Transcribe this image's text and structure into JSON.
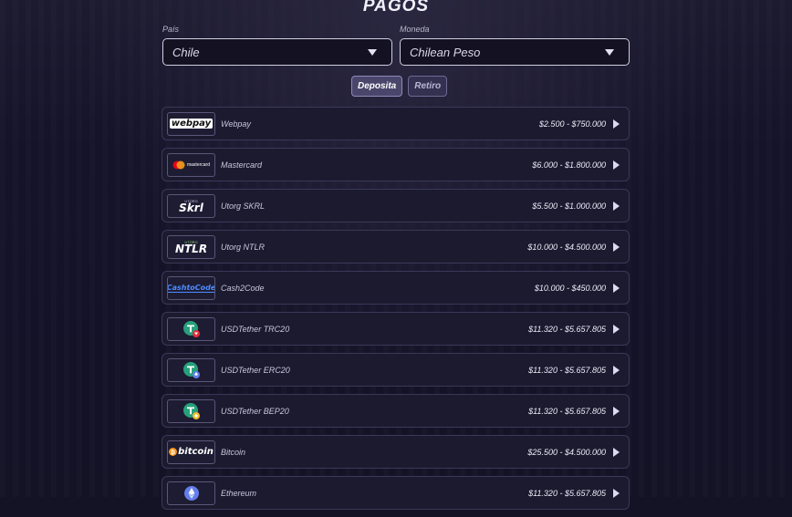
{
  "page": {
    "title": "PAGOS"
  },
  "filters": {
    "country": {
      "label": "País",
      "value": "Chile"
    },
    "currency": {
      "label": "Moneda",
      "value": "Chilean Peso"
    }
  },
  "tabs": [
    {
      "label": "Deposita",
      "active": true
    },
    {
      "label": "Retiro",
      "active": false
    }
  ],
  "methods": [
    {
      "name": "Webpay",
      "range": "$2.500 - $750.000",
      "logo_text": "webpay",
      "icon": "webpay-logo"
    },
    {
      "name": "Mastercard",
      "range": "$6.000 - $1.800.000",
      "logo_text": "mastercard",
      "icon": "mastercard-logo"
    },
    {
      "name": "Utorg SKRL",
      "range": "$5.500 - $1.000.000",
      "logo_text": "Skrl",
      "logo_subtext": "UTORG",
      "icon": "skrill-logo"
    },
    {
      "name": "Utorg NTLR",
      "range": "$10.000 - $4.500.000",
      "logo_text": "NTLR",
      "logo_subtext": "UTORG",
      "icon": "neteller-logo"
    },
    {
      "name": "Cash2Code",
      "range": "$10.000 - $450.000",
      "logo_text": "CashtoCode",
      "icon": "cashtocode-logo"
    },
    {
      "name": "USDTether TRC20",
      "range": "$11.320 - $5.657.805",
      "icon": "tether-trc20-icon"
    },
    {
      "name": "USDTether ERC20",
      "range": "$11.320 - $5.657.805",
      "icon": "tether-erc20-icon"
    },
    {
      "name": "USDTether BEP20",
      "range": "$11.320 - $5.657.805",
      "icon": "tether-bep20-icon"
    },
    {
      "name": "Bitcoin",
      "range": "$25.500 - $4.500.000",
      "logo_text": "bitcoin",
      "icon": "bitcoin-logo"
    },
    {
      "name": "Ethereum",
      "range": "$11.320 - $5.657.805",
      "icon": "ethereum-icon"
    }
  ],
  "colors": {
    "background": "#141225",
    "tether": "#26a17b",
    "bitcoin": "#f7931a",
    "ethereum": "#627eea",
    "mastercard_red": "#eb001b",
    "mastercard_orange": "#f79e1b",
    "cashtocode_blue": "#2a7bff"
  }
}
